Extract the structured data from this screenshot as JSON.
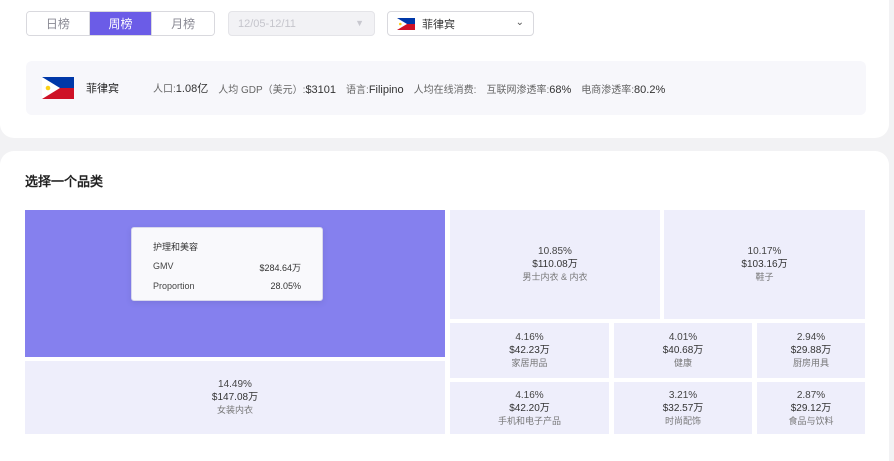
{
  "period_tabs": [
    {
      "label": "日榜",
      "active": false
    },
    {
      "label": "周榜",
      "active": true
    },
    {
      "label": "月榜",
      "active": false
    }
  ],
  "date_range": {
    "value": "12/05-12/11"
  },
  "country_select": {
    "value": "菲律宾",
    "flag": "philippines-flag-icon"
  },
  "country_info": {
    "name": "菲律宾",
    "population_label": "人口:",
    "population": "1.08亿",
    "gdp_label": "人均 GDP（美元）:",
    "gdp": "$3101",
    "language_label": "语言:",
    "language": "Filipino",
    "online_spend_label": "人均在线消费:",
    "online_spend": "",
    "internet_label": "互联网渗透率:",
    "internet": "68%",
    "ecom_label": "电商渗透率:",
    "ecom": "80.2%"
  },
  "section": {
    "title": "选择一个品类"
  },
  "tooltip": {
    "title": "护理和美容",
    "gmv_label": "GMV",
    "gmv": "$284.64万",
    "proportion_label": "Proportion",
    "proportion": "28.05%"
  },
  "categories": [
    {
      "name": "护理和美容",
      "pct": "28.05%",
      "amount": "$284.64万"
    },
    {
      "name": "女装内衣",
      "pct": "14.49%",
      "amount": "$147.08万"
    },
    {
      "name": "男士内衣 & 内衣",
      "pct": "10.85%",
      "amount": "$110.08万"
    },
    {
      "name": "鞋子",
      "pct": "10.17%",
      "amount": "$103.16万"
    },
    {
      "name": "家居用品",
      "pct": "4.16%",
      "amount": "$42.23万"
    },
    {
      "name": "健康",
      "pct": "4.01%",
      "amount": "$40.68万"
    },
    {
      "name": "厨房用具",
      "pct": "2.94%",
      "amount": "$29.88万"
    },
    {
      "name": "手机和电子产品",
      "pct": "4.16%",
      "amount": "$42.20万"
    },
    {
      "name": "时尚配饰",
      "pct": "3.21%",
      "amount": "$32.57万"
    },
    {
      "name": "食品与饮料",
      "pct": "2.87%",
      "amount": "$29.12万"
    }
  ],
  "colors": {
    "accent": "#6b5ce7",
    "treemap_active": "#8580ee",
    "treemap_tile": "#eeeefb"
  }
}
